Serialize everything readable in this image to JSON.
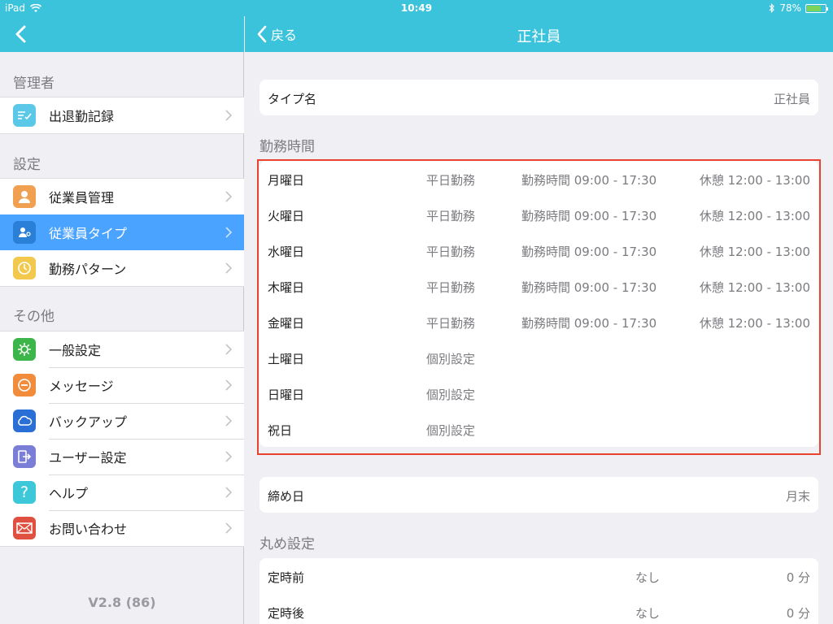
{
  "status_bar": {
    "device": "iPad",
    "time": "10:49",
    "battery": "78%",
    "battery_level": 0.78
  },
  "sidebar": {
    "sections": [
      {
        "title": "管理者",
        "items": [
          {
            "label": "出退勤記録",
            "icon": "list-check-icon",
            "color": "#5bc8e8"
          }
        ]
      },
      {
        "title": "設定",
        "items": [
          {
            "label": "従業員管理",
            "icon": "person-icon",
            "color": "#f0a050"
          },
          {
            "label": "従業員タイプ",
            "icon": "person-badge-icon",
            "color": "#2a7fd6",
            "selected": true
          },
          {
            "label": "勤務パターン",
            "icon": "clock-icon",
            "color": "#f2c94c"
          }
        ]
      },
      {
        "title": "その他",
        "items": [
          {
            "label": "一般設定",
            "icon": "gear-icon",
            "color": "#3cb54a"
          },
          {
            "label": "メッセージ",
            "icon": "message-icon",
            "color": "#f08c3c"
          },
          {
            "label": "バックアップ",
            "icon": "cloud-icon",
            "color": "#2a6fd6"
          },
          {
            "label": "ユーザー設定",
            "icon": "logout-icon",
            "color": "#7a7ed6"
          },
          {
            "label": "ヘルプ",
            "icon": "help-icon",
            "color": "#3cc8d8"
          },
          {
            "label": "お問い合わせ",
            "icon": "mail-icon",
            "color": "#e05040"
          }
        ]
      }
    ],
    "version": "V2.8 (86)"
  },
  "main": {
    "nav": {
      "back_label": "戻る",
      "title": "正社員"
    },
    "type_name": {
      "label": "タイプ名",
      "value": "正社員"
    },
    "schedule_title": "勤務時間",
    "schedule": [
      {
        "day": "月曜日",
        "type": "平日勤務",
        "work": "勤務時間 09:00 - 17:30",
        "break": "休憩 12:00 - 13:00"
      },
      {
        "day": "火曜日",
        "type": "平日勤務",
        "work": "勤務時間 09:00 - 17:30",
        "break": "休憩 12:00 - 13:00"
      },
      {
        "day": "水曜日",
        "type": "平日勤務",
        "work": "勤務時間 09:00 - 17:30",
        "break": "休憩 12:00 - 13:00"
      },
      {
        "day": "木曜日",
        "type": "平日勤務",
        "work": "勤務時間 09:00 - 17:30",
        "break": "休憩 12:00 - 13:00"
      },
      {
        "day": "金曜日",
        "type": "平日勤務",
        "work": "勤務時間 09:00 - 17:30",
        "break": "休憩 12:00 - 13:00"
      },
      {
        "day": "土曜日",
        "type": "個別設定",
        "work": "",
        "break": ""
      },
      {
        "day": "日曜日",
        "type": "個別設定",
        "work": "",
        "break": ""
      },
      {
        "day": "祝日",
        "type": "個別設定",
        "work": "",
        "break": ""
      }
    ],
    "closing_day": {
      "label": "締め日",
      "value": "月末"
    },
    "rounding_title": "丸め設定",
    "rounding": [
      {
        "label": "定時前",
        "mode": "なし",
        "value": "0 分"
      },
      {
        "label": "定時後",
        "mode": "なし",
        "value": "0 分"
      }
    ]
  }
}
